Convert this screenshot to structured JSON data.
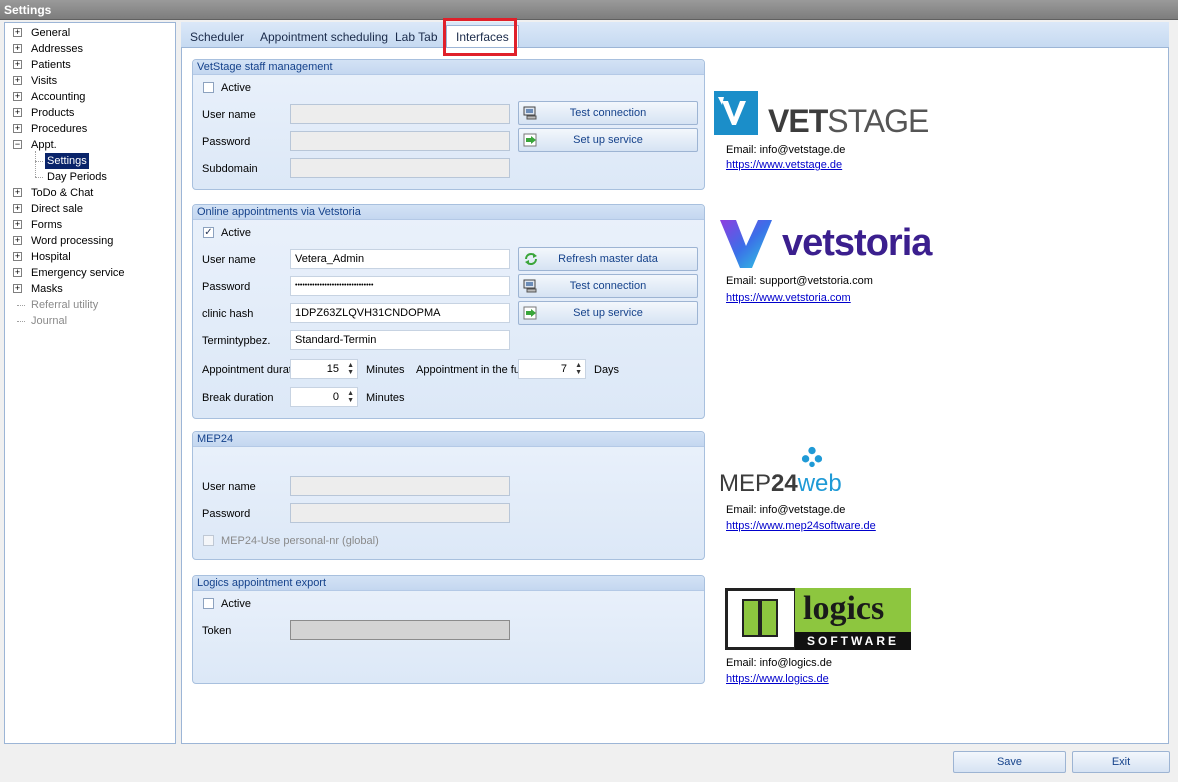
{
  "window": {
    "title": "Settings"
  },
  "tree": {
    "items": [
      {
        "label": "General",
        "expander": "+"
      },
      {
        "label": "Addresses",
        "expander": "+"
      },
      {
        "label": "Patients",
        "expander": "+"
      },
      {
        "label": "Visits",
        "expander": "+"
      },
      {
        "label": "Accounting",
        "expander": "+"
      },
      {
        "label": "Products",
        "expander": "+"
      },
      {
        "label": "Procedures",
        "expander": "+"
      },
      {
        "label": "Appt.",
        "expander": "−"
      },
      {
        "label": "Settings"
      },
      {
        "label": "Day Periods"
      },
      {
        "label": "ToDo & Chat",
        "expander": "+"
      },
      {
        "label": "Direct sale",
        "expander": "+"
      },
      {
        "label": "Forms",
        "expander": "+"
      },
      {
        "label": "Word processing",
        "expander": "+"
      },
      {
        "label": "Hospital",
        "expander": "+"
      },
      {
        "label": "Emergency service",
        "expander": "+"
      },
      {
        "label": "Masks",
        "expander": "+"
      },
      {
        "label": "Referral utility"
      },
      {
        "label": "Journal"
      }
    ]
  },
  "tabs": [
    "Scheduler",
    "Appointment scheduling",
    "Lab Tab",
    "Interfaces"
  ],
  "vetstage_group": {
    "title": "VetStage staff management",
    "active_label": "Active",
    "active_checked": false,
    "username_label": "User name",
    "password_label": "Password",
    "subdomain_label": "Subdomain",
    "test_connection": "Test connection",
    "setup_service": "Set up service"
  },
  "vetstoria_group": {
    "title": "Online appointments via Vetstoria",
    "active_label": "Active",
    "active_checked": true,
    "check_mark": "✓",
    "username_label": "User name",
    "username_value": "Vetera_Admin",
    "password_label": "Password",
    "password_value": "••••••••••••••••••••••••••••••••",
    "clinic_hash_label": "clinic hash",
    "clinic_hash_value": "1DPZ63ZLQVH31CNDOPMA",
    "termintyp_label": "Termintypbez.",
    "termintyp_value": "Standard-Termin",
    "duration_label": "Appointment duration",
    "duration_value": "15",
    "minutes_label": "Minutes",
    "future_label": "Appointment in the future",
    "future_value": "7",
    "days_label": "Days",
    "break_label": "Break duration",
    "break_value": "0",
    "break_minutes_label": "Minutes",
    "refresh_master": "Refresh master data",
    "test_connection": "Test connection",
    "setup_service": "Set up service"
  },
  "mep_group": {
    "title": "MEP24",
    "username_label": "User name",
    "password_label": "Password",
    "personal_nr_label": "MEP24-Use personal-nr (global)"
  },
  "logics_group": {
    "title": "Logics appointment export",
    "active_label": "Active",
    "token_label": "Token"
  },
  "logos": {
    "vetstage": {
      "text_a": "VET",
      "text_b": "STAGE",
      "email": "Email: info@vetstage.de",
      "url": "https://www.vetstage.de",
      "color": "#1b8ec9"
    },
    "vetstoria": {
      "text": "vetstoria",
      "email": "Email: support@vetstoria.com",
      "url": "https://www.vetstoria.com",
      "color": "#3b1f8e"
    },
    "mep24": {
      "text_a": "MEP",
      "text_b": "24",
      "text_c": "web",
      "email": "Email: info@vetstage.de",
      "url": "https://www.mep24software.de",
      "color": "#1f9ad6"
    },
    "logics": {
      "text_a": "logics",
      "text_b": "SOFTWARE",
      "email": "Email: info@logics.de",
      "url": "https://www.logics.de",
      "color": "#8dc63f"
    }
  },
  "footer": {
    "save": "Save",
    "exit": "Exit"
  },
  "icons": {
    "expander": "tree-expander-icon",
    "computer": "computer-icon",
    "arrow": "green-arrow-icon",
    "refresh": "refresh-icon",
    "spin_up": "▲",
    "spin_down": "▼"
  }
}
